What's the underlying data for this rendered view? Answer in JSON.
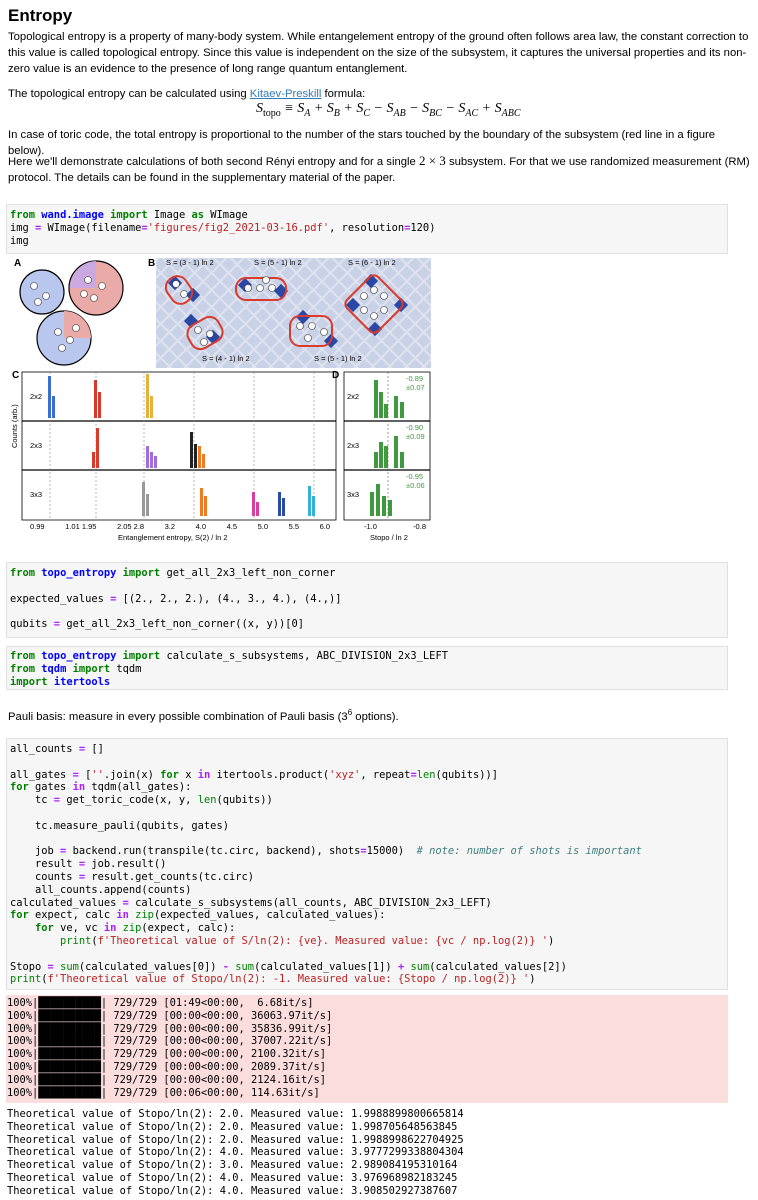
{
  "title": "Entropy",
  "intro": {
    "para1": "Topological entropy is a property of many-body system. While entangelement entropy of the ground often follows area law, the constant correction to this value is called topological entropy. Since this value is independent on the size of the subsystem, it captures the universal properties and its non-zero value is an evidence to the presence of long range quantum entanglement.",
    "para2_prefix": "The topological entropy can be calculated using ",
    "para2_link": "Kitaev-Preskill",
    "para2_suffix": " formula:",
    "para3": "In case of toric code, the total entropy is proportional to the number of the stars touched by the boundary of the subsystem (red line in a figure below).",
    "para4_a": "Here we'll demonstrate calculations of both second Rényi entropy and for a single ",
    "para4_math": "2 × 3",
    "para4_b": " subsystem. For that we use randomized measurement (RM) protocol. The details can be found in the supplementary material of the paper."
  },
  "pauli_text_a": "Pauli basis: measure in every possible combination of Pauli basis (3",
  "pauli_text_sup": "6",
  "pauli_text_b": " options).",
  "figure": {
    "panel_labels": [
      "A",
      "B",
      "C",
      "D"
    ],
    "b_labels": [
      "S = (3 - 1) ln 2",
      "S = (5 - 1) ln 2",
      "S = (6 - 1) ln 2",
      "S = (4 - 1) ln 2",
      "S = (5 - 1) ln 2"
    ],
    "c_rows": [
      "2x2",
      "2x3",
      "3x3"
    ],
    "d_rows": [
      "2x2",
      "2x3",
      "3x3"
    ],
    "d_values": [
      [
        "-0.89",
        "±0.07"
      ],
      [
        "-0.90",
        "±0.09"
      ],
      [
        "-0.95",
        "±0.06"
      ]
    ],
    "c_ticks": [
      "0.99",
      "1.01 1.95",
      "2.05 2.8",
      "3.2",
      "4.0",
      "4.5",
      "5.0",
      "5.5",
      "6.0"
    ],
    "d_ticks": [
      "-1.0",
      "-0.8"
    ],
    "c_ylabel": "Counts (arb.)",
    "c_xlabel": "Entanglement entropy, S(2) / ln 2",
    "d_xlabel": "Stopo / ln 2"
  },
  "progress_lines": [
    "100%|██████████| 729/729 [01:49<00:00,  6.68it/s]",
    "100%|██████████| 729/729 [00:00<00:00, 36063.97it/s]",
    "100%|██████████| 729/729 [00:00<00:00, 35836.99it/s]",
    "100%|██████████| 729/729 [00:00<00:00, 37007.22it/s]",
    "100%|██████████| 729/729 [00:00<00:00, 2100.32it/s]",
    "100%|██████████| 729/729 [00:00<00:00, 2089.37it/s]",
    "100%|██████████| 729/729 [00:00<00:00, 2124.16it/s]",
    "100%|██████████| 729/729 [00:06<00:00, 114.63it/s]"
  ],
  "output_lines": [
    "Theoretical value of Stopo/ln(2): 2.0. Measured value: 1.9988899800665814",
    "Theoretical value of Stopo/ln(2): 2.0. Measured value: 1.998705648563845",
    "Theoretical value of Stopo/ln(2): 2.0. Measured value: 1.9988998622704925",
    "Theoretical value of Stopo/ln(2): 4.0. Measured value: 3.9777299338804304",
    "Theoretical value of Stopo/ln(2): 3.0. Measured value: 2.989084195310164",
    "Theoretical value of Stopo/ln(2): 4.0. Measured value: 3.976968982183245",
    "Theoretical value of Stopo/ln(2): 4.0. Measured value: 3.908502927387607"
  ]
}
